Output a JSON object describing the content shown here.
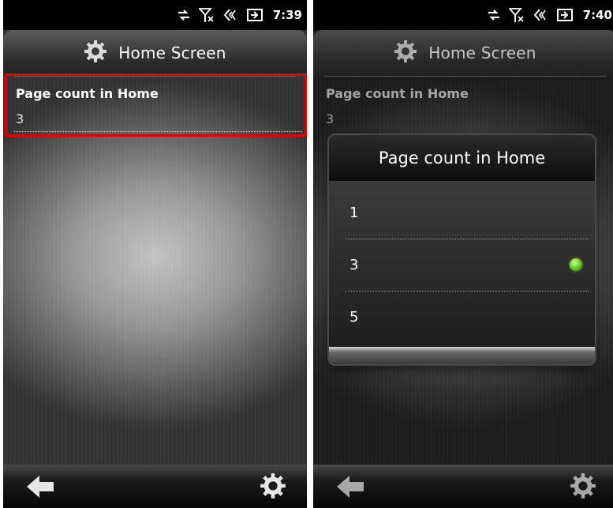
{
  "screens": [
    {
      "status": {
        "time": "7:39"
      },
      "header": {
        "title": "Home Screen",
        "icon": "gear-icon"
      },
      "setting": {
        "label": "Page count in Home",
        "value": "3"
      },
      "highlight_color": "#e00000",
      "bottom_bar": {
        "left_icon": "back-arrow-icon",
        "right_icon": "gear-icon"
      }
    },
    {
      "status": {
        "time": "7:40"
      },
      "header": {
        "title": "Home Screen",
        "icon": "gear-icon"
      },
      "setting": {
        "label": "Page count in Home",
        "value": "3"
      },
      "dialog": {
        "title": "Page count in Home",
        "options": [
          "1",
          "3",
          "5"
        ],
        "selected": "3",
        "selected_color": "#6ed12b"
      },
      "bottom_bar": {
        "left_icon": "back-arrow-icon",
        "right_icon": "gear-icon"
      }
    }
  ]
}
